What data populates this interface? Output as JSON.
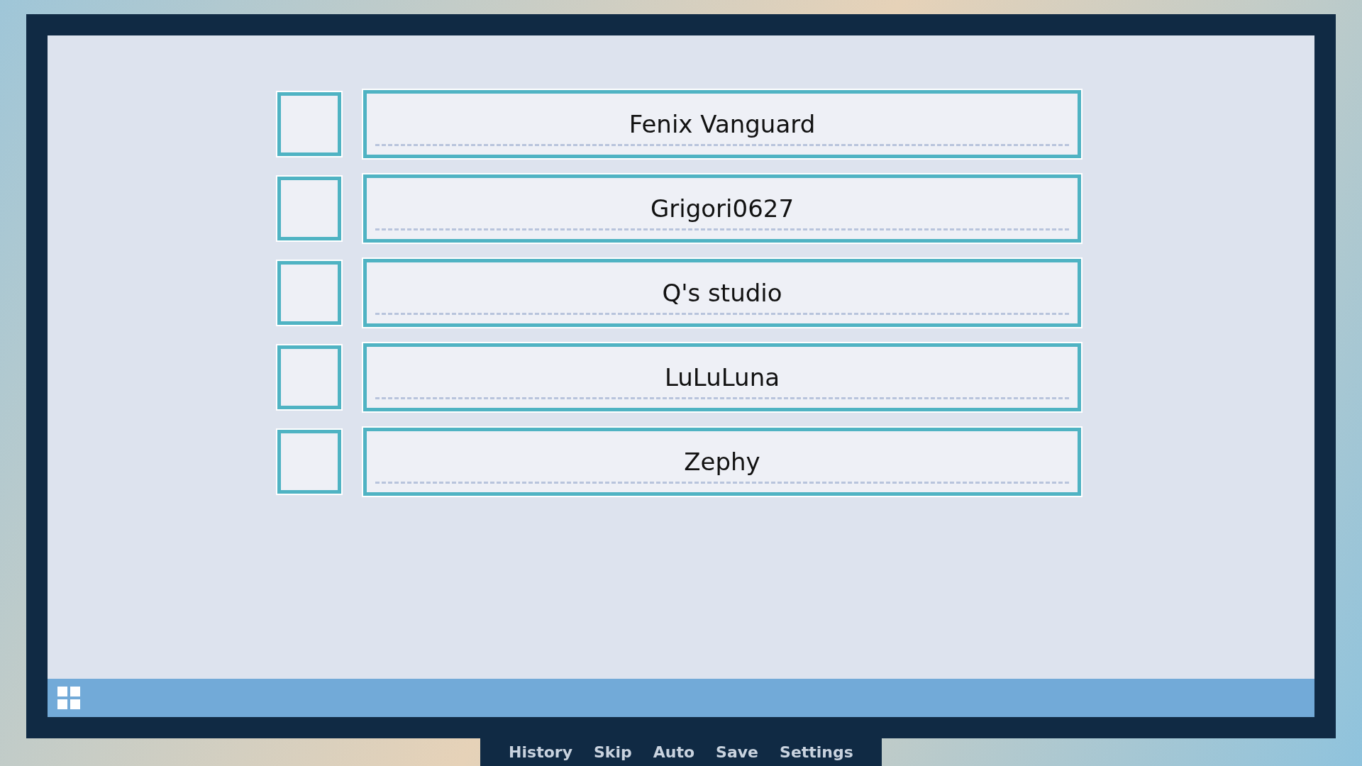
{
  "choices": [
    {
      "label": "Fenix Vanguard",
      "checked": false
    },
    {
      "label": "Grigori0627",
      "checked": false
    },
    {
      "label": "Q's studio",
      "checked": false
    },
    {
      "label": "LuLuLuna",
      "checked": false
    },
    {
      "label": "Zephy",
      "checked": false
    }
  ],
  "menu": [
    "History",
    "Skip",
    "Auto",
    "Save",
    "Settings"
  ]
}
